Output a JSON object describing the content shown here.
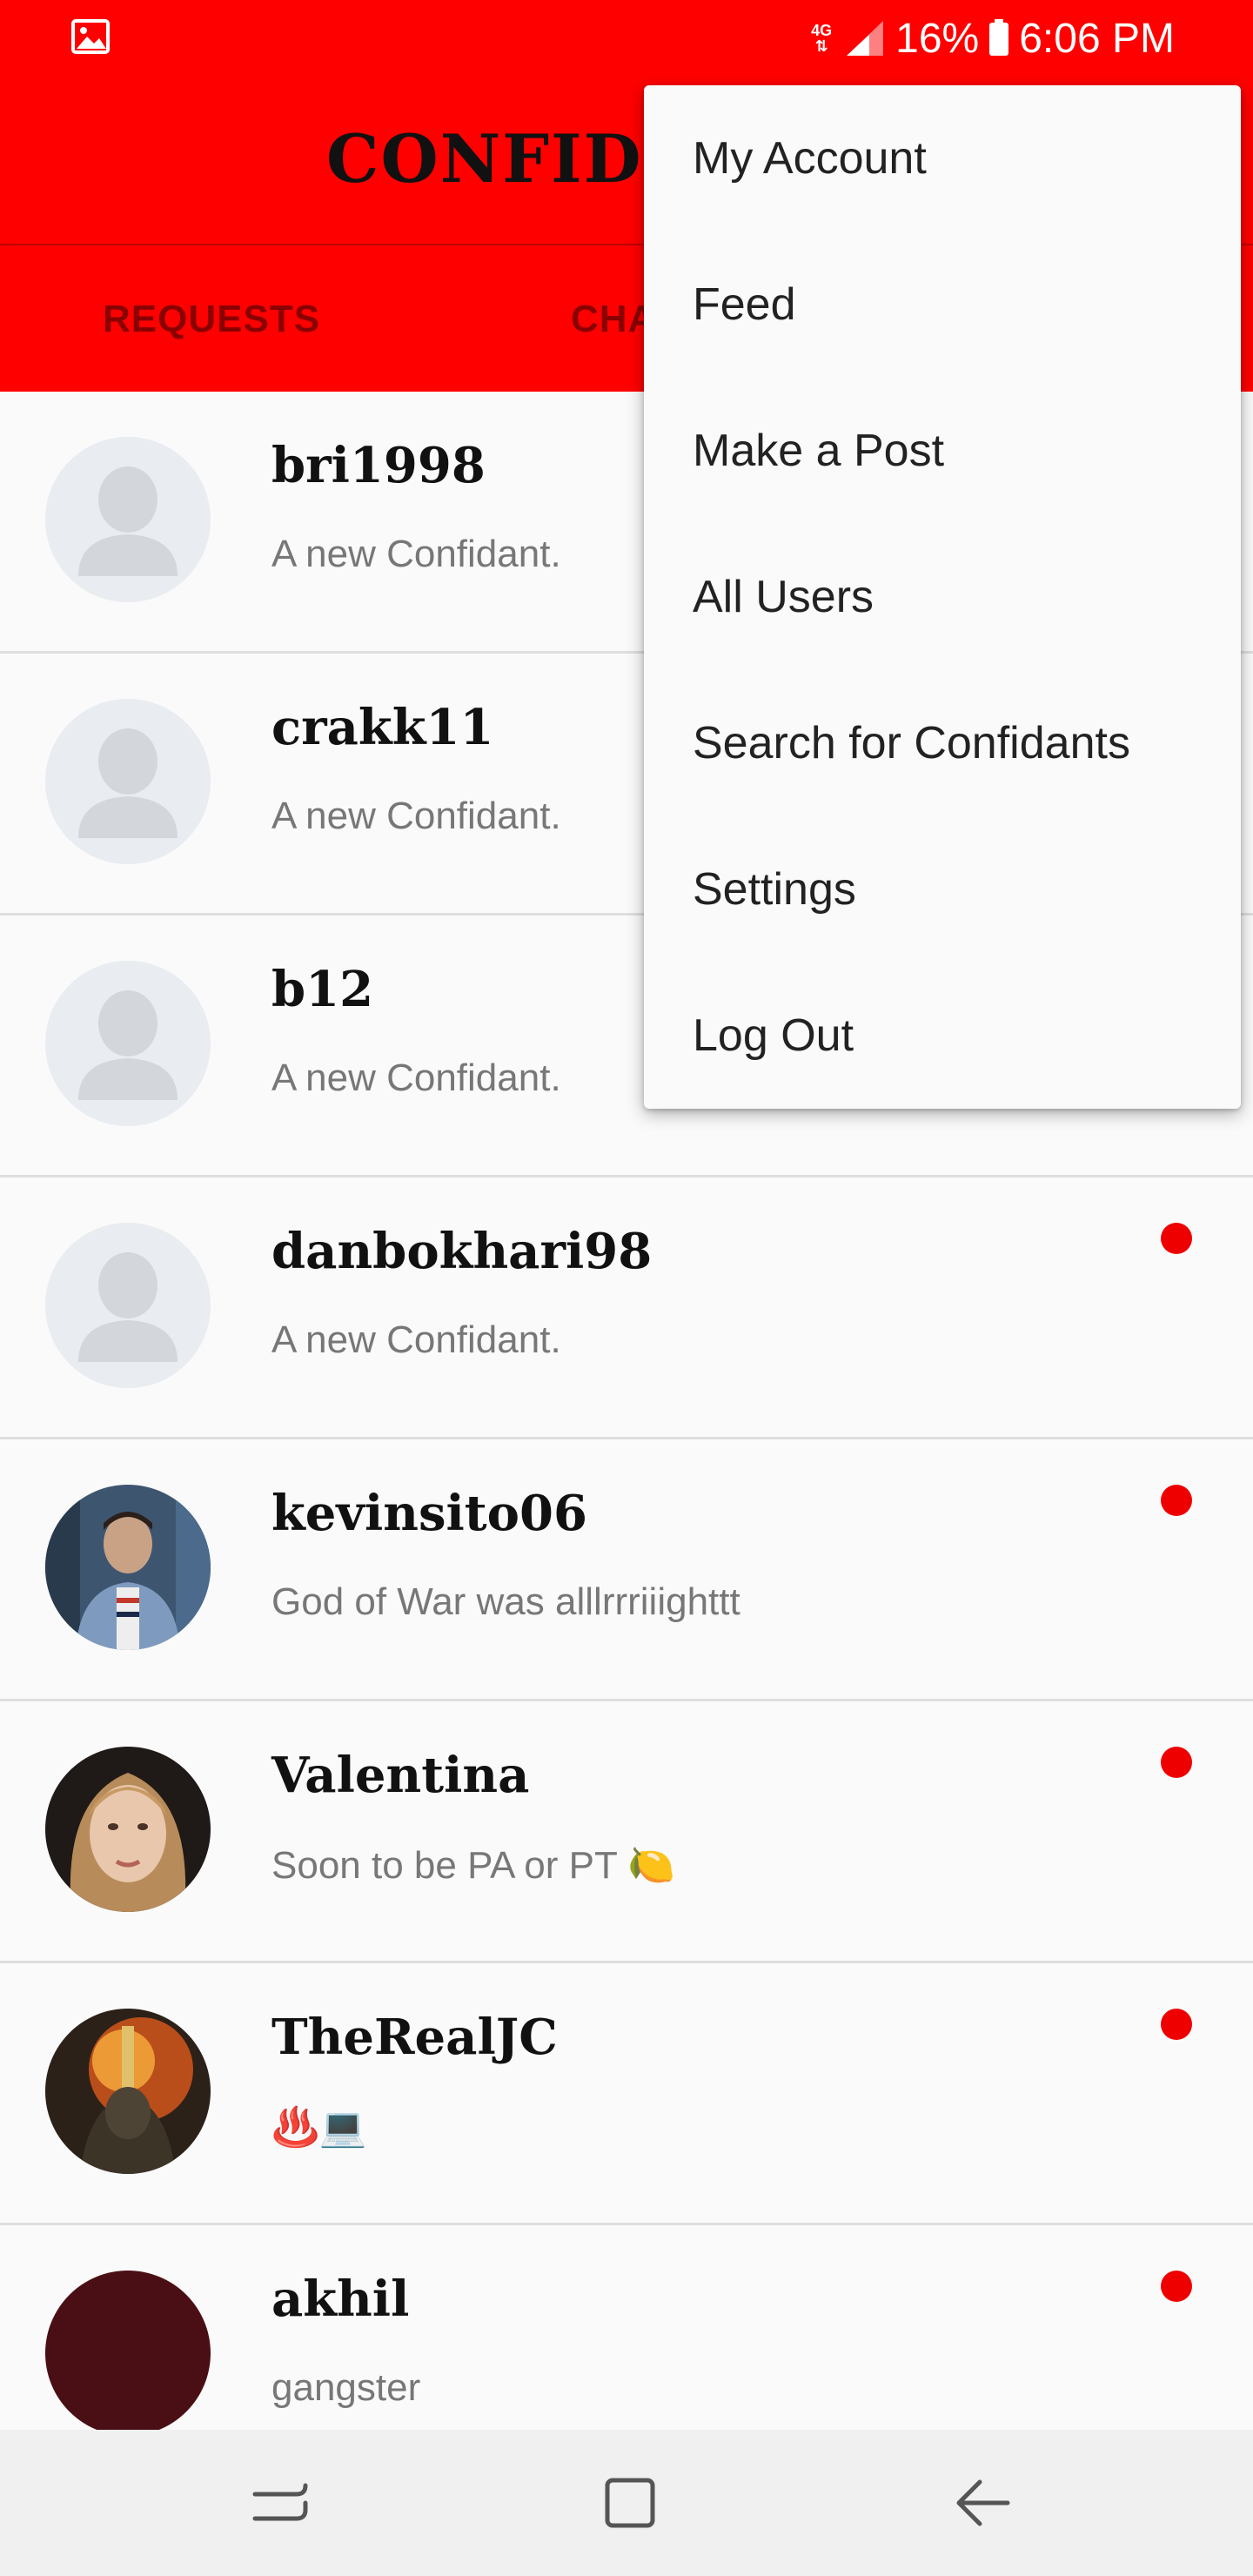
{
  "status_bar": {
    "network": "4G LTE",
    "battery": "16%",
    "time": "6:06 PM",
    "icons": [
      "gallery-icon",
      "network-4g-icon",
      "signal-icon",
      "battery-icon"
    ]
  },
  "app_bar": {
    "title": "CONFIDE"
  },
  "tabs": [
    {
      "label": "REQUESTS"
    },
    {
      "label": "CHA"
    }
  ],
  "menu": {
    "items": [
      {
        "label": "My Account"
      },
      {
        "label": "Feed"
      },
      {
        "label": "Make a Post"
      },
      {
        "label": "All Users"
      },
      {
        "label": "Search for Confidants"
      },
      {
        "label": "Settings"
      },
      {
        "label": "Log Out"
      }
    ]
  },
  "chats": [
    {
      "username": "bri1998",
      "message": "A new Confidant.",
      "unread": false,
      "avatar": "default-avatar"
    },
    {
      "username": "crakk11",
      "message": "A new Confidant.",
      "unread": false,
      "avatar": "default-avatar"
    },
    {
      "username": "b12",
      "message": "A new Confidant.",
      "unread": false,
      "avatar": "default-avatar"
    },
    {
      "username": "danbokhari98",
      "message": "A new Confidant.",
      "unread": true,
      "avatar": "default-avatar"
    },
    {
      "username": "kevinsito06",
      "message": "God of War was alllrrriiighttt",
      "unread": true,
      "avatar": "photo"
    },
    {
      "username": "Valentina",
      "message": "Soon to be PA or PT 🍋",
      "unread": true,
      "avatar": "photo"
    },
    {
      "username": "TheRealJC",
      "message": "♨️💻",
      "unread": true,
      "avatar": "photo"
    },
    {
      "username": "akhil",
      "message": "gangster",
      "unread": true,
      "avatar": "photo"
    }
  ],
  "colors": {
    "primary": "#ff0000",
    "tab_text": "#8a0000",
    "unread_dot": "#ee0000",
    "background": "#fafafa"
  },
  "nav_bar": {
    "buttons": [
      "recent-apps-button",
      "home-button",
      "back-button"
    ]
  }
}
